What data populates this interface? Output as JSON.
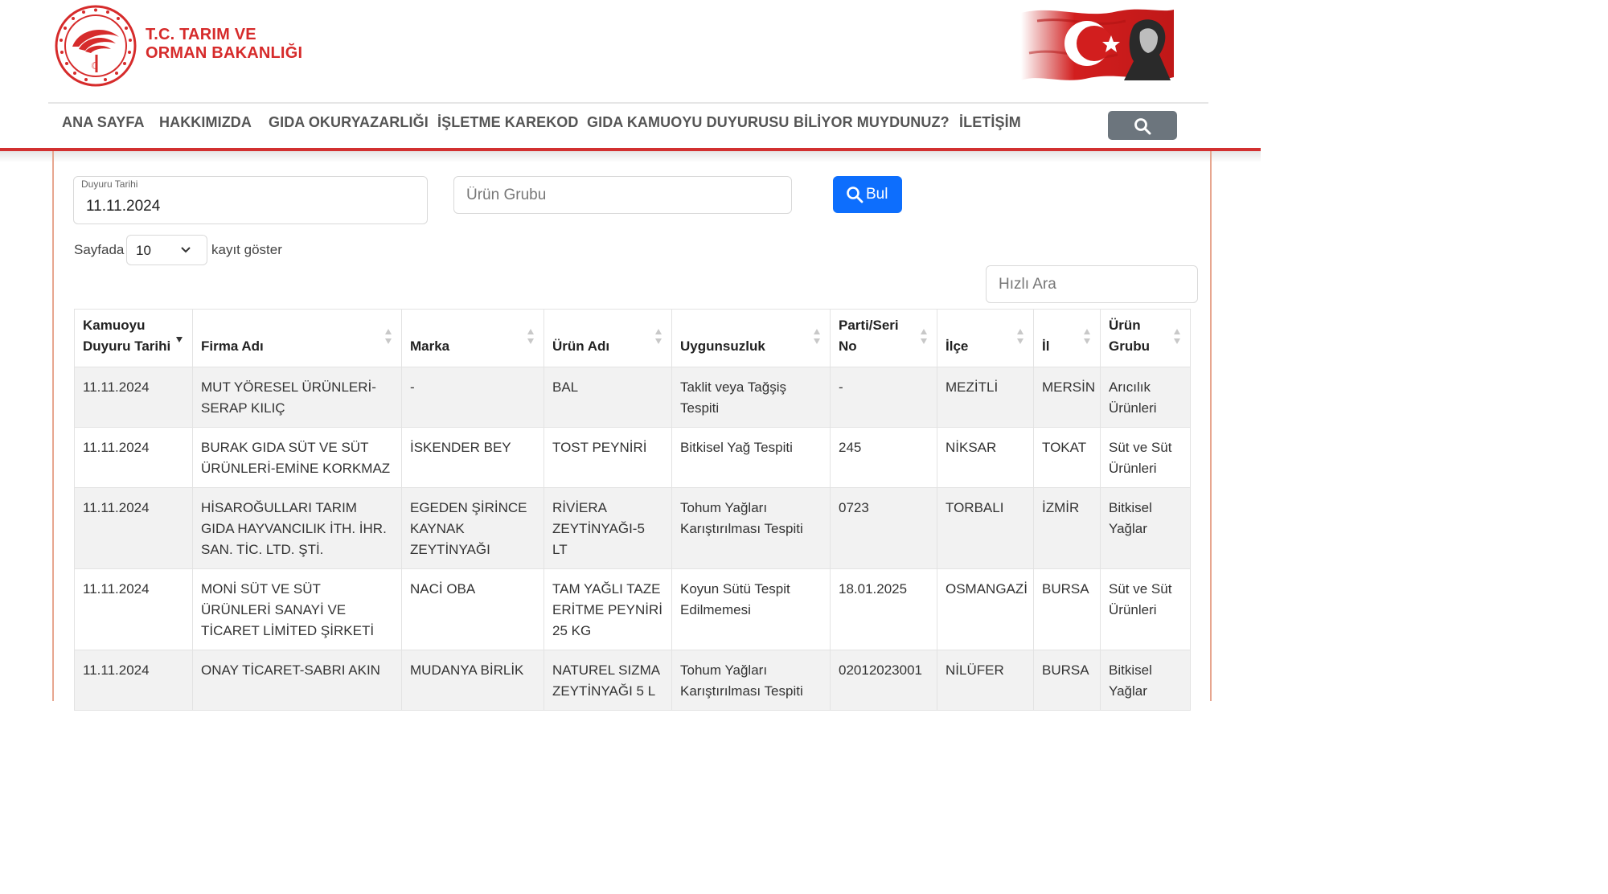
{
  "header": {
    "ministry_line1": "T.C. TARIM VE",
    "ministry_line2": "ORMAN BAKANLIĞI",
    "brand_color": "#d62b2b"
  },
  "nav": {
    "items": [
      {
        "label": "ANA SAYFA"
      },
      {
        "label": "HAKKIMIZDA"
      },
      {
        "label": "GIDA OKURYAZARLIĞI"
      },
      {
        "label": "İŞLETME KAREKOD"
      },
      {
        "label": "GIDA KAMUOYU DUYURUSU"
      },
      {
        "label": "BİLİYOR MUYDUNUZ?"
      },
      {
        "label": "İLETİŞİM"
      }
    ],
    "search_icon": "search-icon"
  },
  "filters": {
    "date_label": "Duyuru Tarihi",
    "date_value": "11.11.2024",
    "product_group_placeholder": "Ürün Grubu",
    "find_label": "Bul",
    "accent_color": "#0d6efd"
  },
  "length": {
    "prefix": "Sayfada",
    "value": "10",
    "suffix": "kayıt göster"
  },
  "quick_search": {
    "placeholder": "Hızlı Ara"
  },
  "table": {
    "headers": [
      {
        "label": "Kamuoyu Duyuru Tarihi",
        "sorted": "desc"
      },
      {
        "label": "Firma Adı"
      },
      {
        "label": "Marka"
      },
      {
        "label": "Ürün Adı"
      },
      {
        "label": "Uygunsuzluk"
      },
      {
        "label": "Parti/Seri No"
      },
      {
        "label": "İlçe"
      },
      {
        "label": "İl"
      },
      {
        "label": "Ürün Grubu"
      }
    ],
    "rows": [
      [
        "11.11.2024",
        "MUT YÖRESEL ÜRÜNLERİ-SERAP KILIÇ",
        "-",
        "BAL",
        "Taklit veya Tağşiş Tespiti",
        "-",
        "MEZİTLİ",
        "MERSİN",
        "Arıcılık Ürünleri"
      ],
      [
        "11.11.2024",
        "BURAK GIDA SÜT VE SÜT ÜRÜNLERİ-EMİNE KORKMAZ",
        "İSKENDER BEY",
        "TOST PEYNİRİ",
        "Bitkisel Yağ Tespiti",
        "245",
        "NİKSAR",
        "TOKAT",
        "Süt ve Süt Ürünleri"
      ],
      [
        "11.11.2024",
        "HİSAROĞULLARI TARIM GIDA HAYVANCILIK İTH. İHR. SAN. TİC. LTD. ŞTİ.",
        "EGEDEN ŞİRİNCE KAYNAK ZEYTİNYAĞI",
        "RİVİERA ZEYTİNYAĞI-5 LT",
        "Tohum Yağları Karıştırılması Tespiti",
        "0723",
        "TORBALI",
        "İZMİR",
        "Bitkisel Yağlar"
      ],
      [
        "11.11.2024",
        "MONİ SÜT VE SÜT ÜRÜNLERİ SANAYİ VE TİCARET LİMİTED ŞİRKETİ",
        "NACİ OBA",
        "TAM YAĞLI TAZE ERİTME PEYNİRİ 25 KG",
        "Koyun Sütü Tespit Edilmemesi",
        "18.01.2025",
        "OSMANGAZİ",
        "BURSA",
        "Süt ve Süt Ürünleri"
      ],
      [
        "11.11.2024",
        "ONAY TİCARET-SABRI AKIN",
        "MUDANYA BİRLİK",
        "NATUREL SIZMA ZEYTİNYAĞI 5 L",
        "Tohum Yağları Karıştırılması Tespiti",
        "02012023001",
        "NİLÜFER",
        "BURSA",
        "Bitkisel Yağlar"
      ]
    ]
  }
}
